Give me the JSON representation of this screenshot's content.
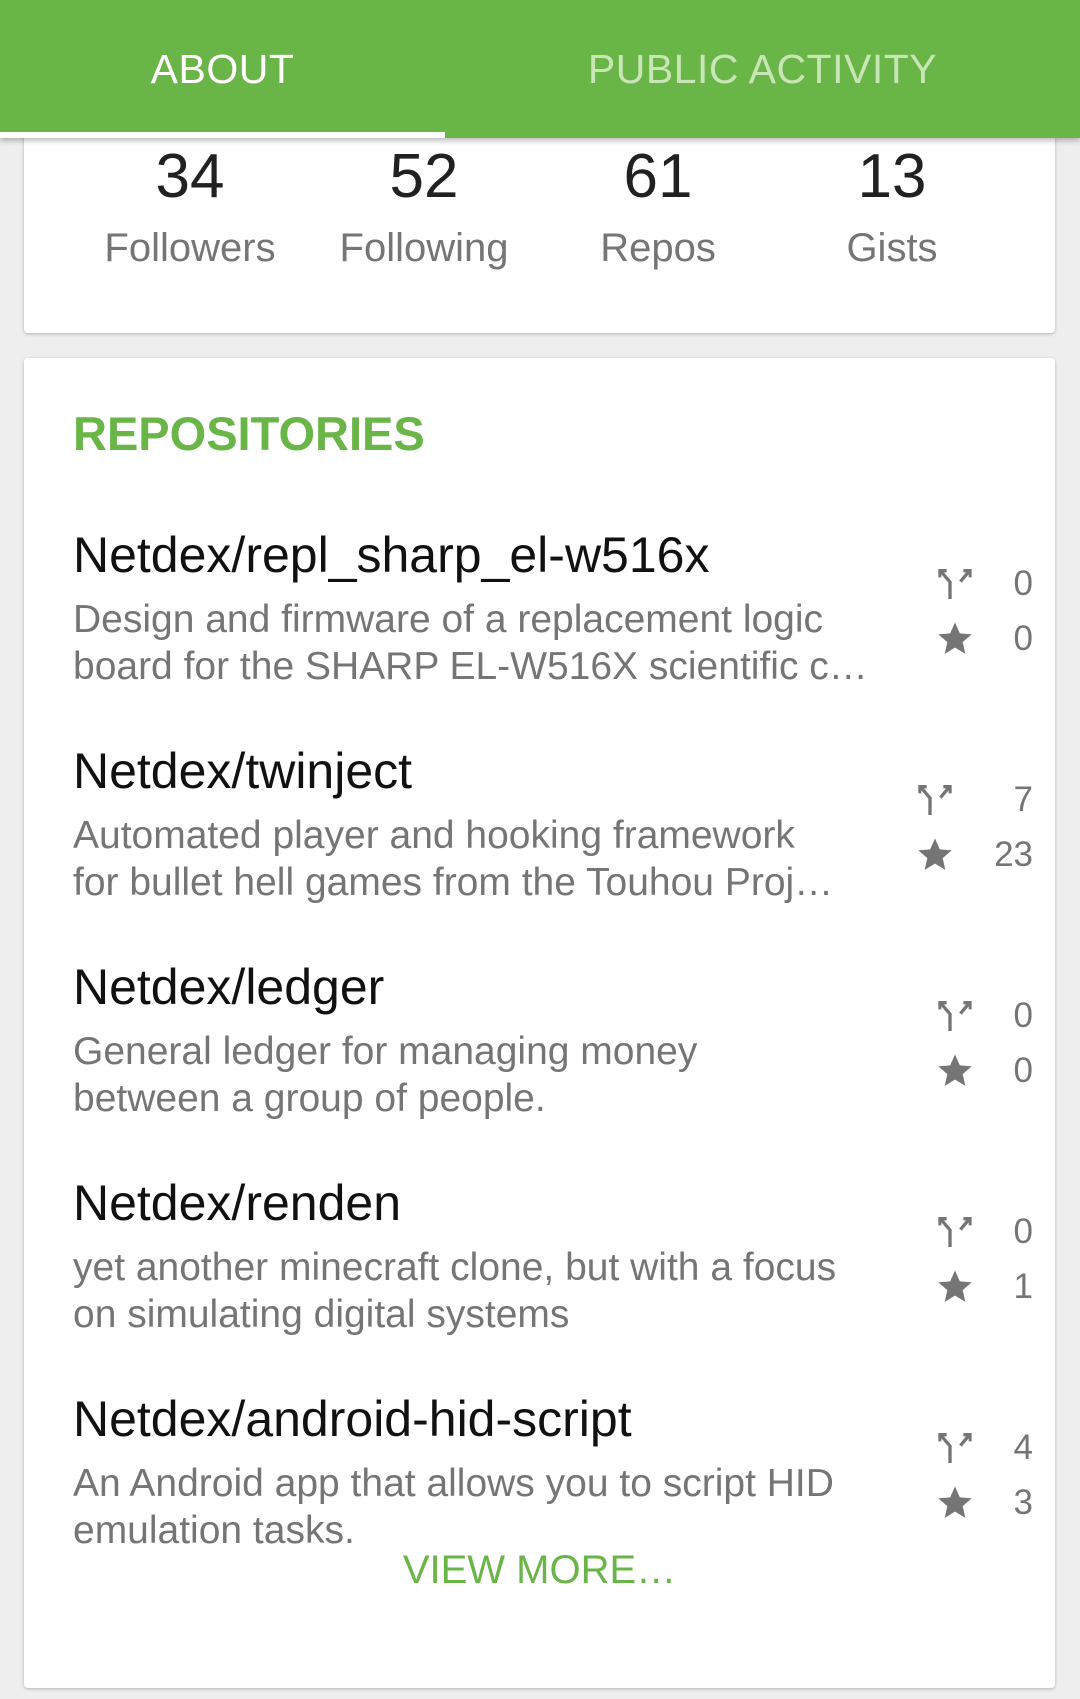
{
  "colors": {
    "accent": "#6ab547",
    "tab_inactive_text": "#c8e6b5",
    "primary_text": "#111111",
    "secondary_text": "#757575"
  },
  "tabs": [
    {
      "label": "ABOUT",
      "selected": true
    },
    {
      "label": "PUBLIC ACTIVITY",
      "selected": false
    }
  ],
  "stats": [
    {
      "value": "34",
      "label": "Followers"
    },
    {
      "value": "52",
      "label": "Following"
    },
    {
      "value": "61",
      "label": "Repos"
    },
    {
      "value": "13",
      "label": "Gists"
    }
  ],
  "repositories": {
    "title": "REPOSITORIES",
    "items": [
      {
        "name": "Netdex/repl_sharp_el-w516x",
        "desc_lines": [
          "Design and firmware of a replacement logic",
          "board for the SHARP EL-W516X scientific c…"
        ],
        "forks": "0",
        "stars": "0"
      },
      {
        "name": "Netdex/twinject",
        "desc_lines": [
          "Automated player and hooking framework",
          "for bullet hell games from the Touhou Proj…"
        ],
        "forks": "7",
        "stars": "23"
      },
      {
        "name": "Netdex/ledger",
        "desc_lines": [
          "General ledger for managing money",
          "between a group of people."
        ],
        "forks": "0",
        "stars": "0"
      },
      {
        "name": "Netdex/renden",
        "desc_lines": [
          "yet another minecraft clone, but with a focus",
          "on simulating digital systems"
        ],
        "forks": "0",
        "stars": "1"
      },
      {
        "name": "Netdex/android-hid-script",
        "desc_lines": [
          "An Android app that allows you to script HID",
          "emulation tasks."
        ],
        "forks": "4",
        "stars": "3"
      }
    ],
    "view_more": "VIEW MORE…",
    "icons": {
      "fork": "fork-icon",
      "star": "star-icon"
    }
  }
}
